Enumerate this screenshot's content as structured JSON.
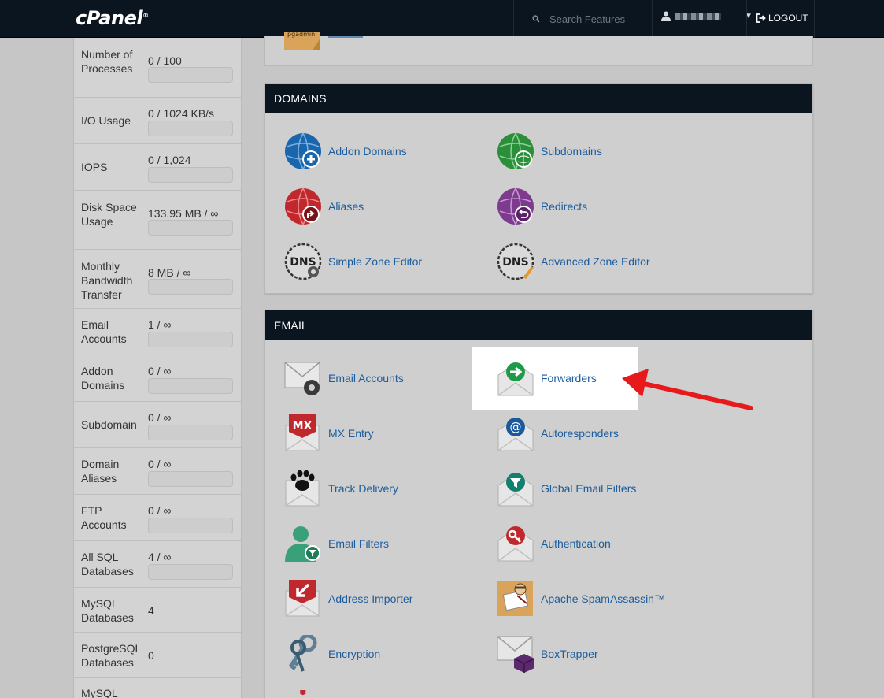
{
  "header": {
    "logo": "cPanel",
    "logo_mark": "®",
    "search_placeholder": "Search Features",
    "logout_label": "LOGOUT"
  },
  "sidebar": {
    "stats": [
      {
        "label": "Number of Processes",
        "value": "0 / 100",
        "usage_fraction": 0
      },
      {
        "label": "I/O Usage",
        "value": "0 / 1024 KB/s",
        "usage_fraction": 0
      },
      {
        "label": "IOPS",
        "value": "0 / 1,024",
        "usage_fraction": 0
      },
      {
        "label": "Disk Space Usage",
        "value": "133.95 MB / ∞",
        "usage_fraction": 0
      },
      {
        "label": "Monthly Bandwidth Transfer",
        "value": "8 MB / ∞",
        "usage_fraction": 0
      },
      {
        "label": "Email Accounts",
        "value": "1 / ∞",
        "usage_fraction": 0
      },
      {
        "label": "Addon Domains",
        "value": "0 / ∞",
        "usage_fraction": 0
      },
      {
        "label": "Subdomain",
        "value": "0 / ∞",
        "usage_fraction": 0
      },
      {
        "label": "Domain Aliases",
        "value": "0 / ∞",
        "usage_fraction": 0
      },
      {
        "label": "FTP Accounts",
        "value": "0 / ∞",
        "usage_fraction": 0
      },
      {
        "label": "All SQL Databases",
        "value": "4 / ∞",
        "usage_fraction": 0
      },
      {
        "label": "MySQL Databases",
        "value": "4"
      },
      {
        "label": "PostgreSQL Databases",
        "value": "0"
      },
      {
        "label": "MySQL",
        "value": ""
      }
    ]
  },
  "domains": {
    "title": "DOMAINS",
    "items": [
      {
        "label": "Addon Domains",
        "icon": "addon-domains-icon"
      },
      {
        "label": "Subdomains",
        "icon": "subdomains-icon"
      },
      {
        "label": "Aliases",
        "icon": "aliases-icon"
      },
      {
        "label": "Redirects",
        "icon": "redirects-icon"
      },
      {
        "label": "Simple Zone Editor",
        "icon": "simple-zone-editor-icon"
      },
      {
        "label": "Advanced Zone Editor",
        "icon": "advanced-zone-editor-icon"
      }
    ]
  },
  "email": {
    "title": "EMAIL",
    "items": [
      {
        "label": "Email Accounts",
        "icon": "email-accounts-icon"
      },
      {
        "label": "Forwarders",
        "icon": "forwarders-icon"
      },
      {
        "label": "MX Entry",
        "icon": "mx-entry-icon"
      },
      {
        "label": "Autoresponders",
        "icon": "autoresponders-icon"
      },
      {
        "label": "Track Delivery",
        "icon": "track-delivery-icon"
      },
      {
        "label": "Global Email Filters",
        "icon": "global-email-filters-icon"
      },
      {
        "label": "Email Filters",
        "icon": "email-filters-icon"
      },
      {
        "label": "Authentication",
        "icon": "authentication-icon"
      },
      {
        "label": "Address Importer",
        "icon": "address-importer-icon"
      },
      {
        "label": "Apache SpamAssassin™",
        "icon": "spamassassin-icon"
      },
      {
        "label": "Encryption",
        "icon": "encryption-icon"
      },
      {
        "label": "BoxTrapper",
        "icon": "boxtrapper-icon"
      }
    ]
  },
  "databases_partial_icon_text": "pgadmin",
  "icon_text": {
    "dns": "DNS",
    "mx": "MX"
  },
  "colors": {
    "topbar": "#0b1520",
    "link": "#1b5c9d",
    "highlight_arrow": "#e8191b"
  }
}
